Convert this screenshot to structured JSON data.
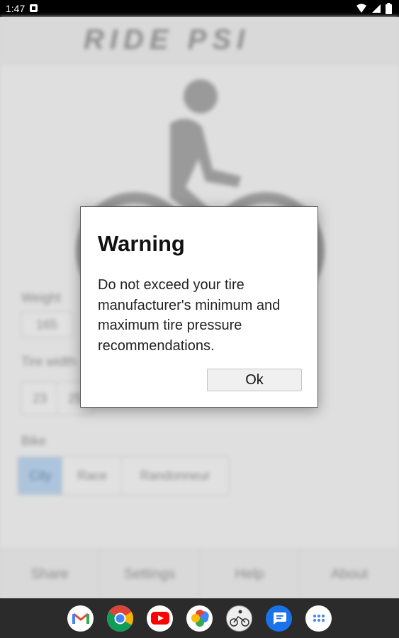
{
  "status_bar": {
    "time": "1:47"
  },
  "app": {
    "logo_text": "RIDE PSI",
    "form": {
      "weight_label": "Weight",
      "weight_value": "165",
      "tire_width_label": "Tire width",
      "tire_width_options": [
        "23",
        "25"
      ],
      "bike_label": "Bike",
      "bike_options": [
        "City",
        "Race",
        "Randonneur"
      ]
    },
    "tabs": [
      "Share",
      "Settings",
      "Help",
      "About"
    ]
  },
  "dialog": {
    "title": "Warning",
    "message": "Do not exceed your tire manufacturer's minimum and maximum tire pressure recommendations.",
    "ok_label": "Ok"
  },
  "dock": {
    "apps": [
      "gmail-icon",
      "chrome-icon",
      "youtube-icon",
      "photos-icon",
      "ride-psi-icon",
      "messages-icon",
      "app-drawer-icon"
    ]
  }
}
